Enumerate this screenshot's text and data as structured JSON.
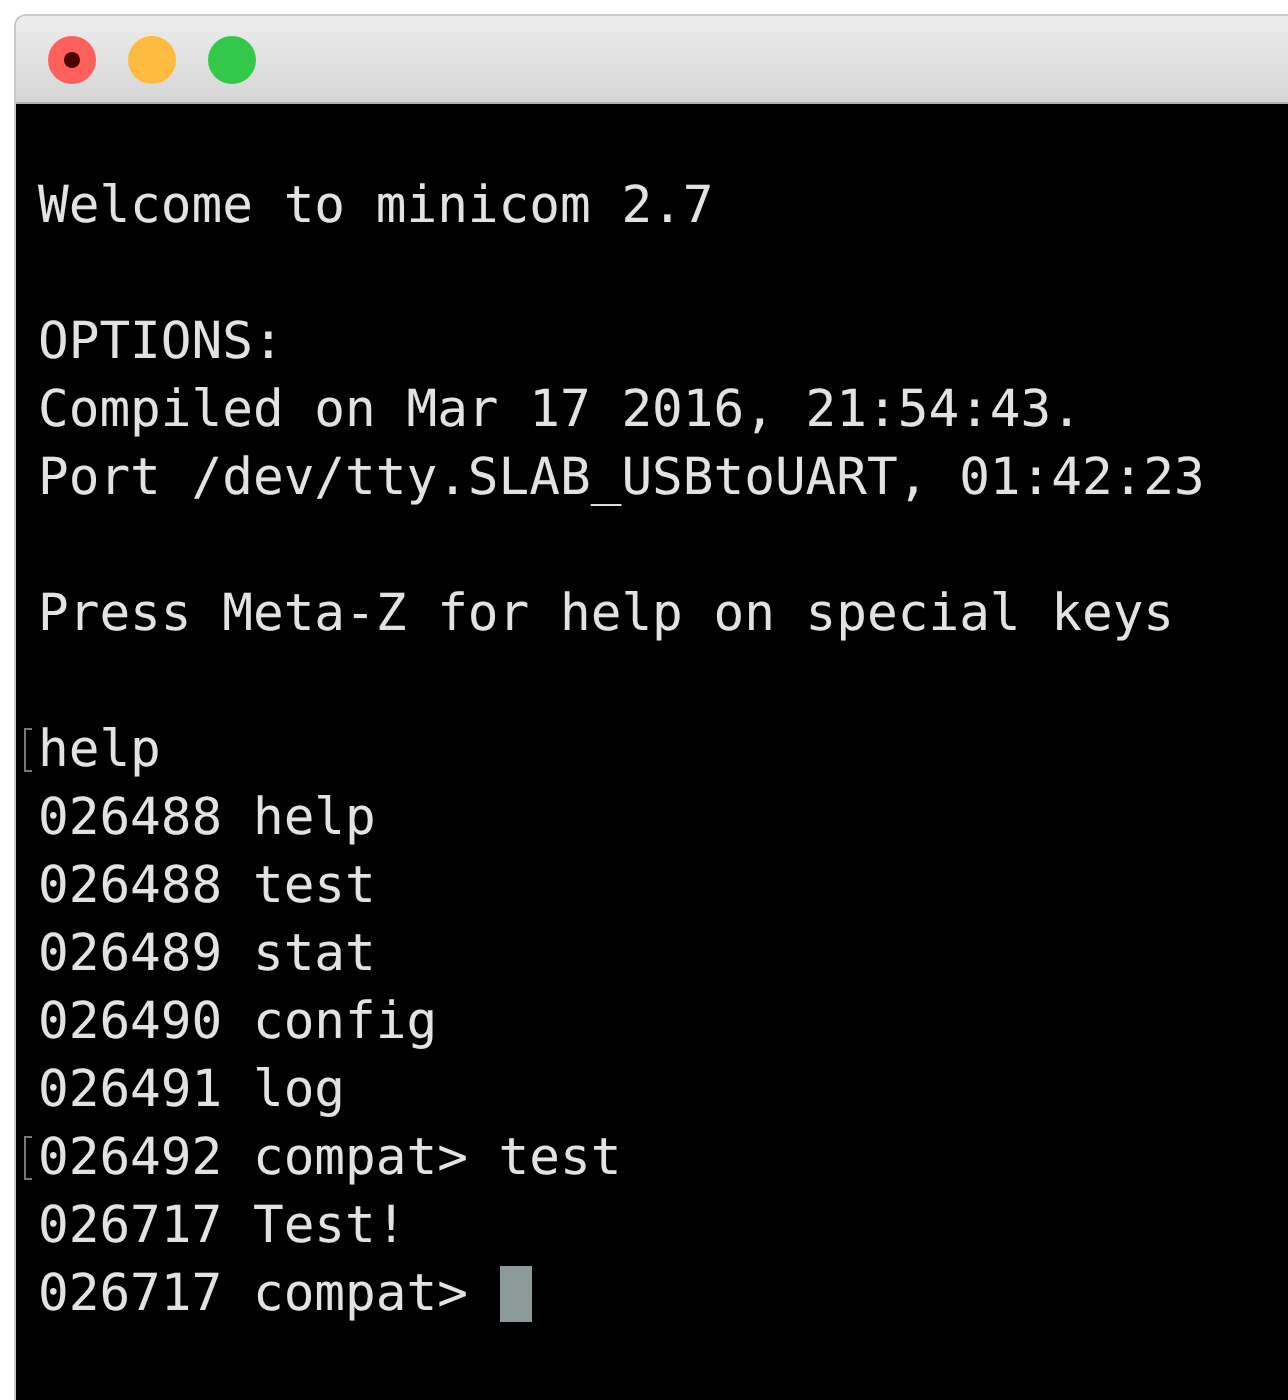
{
  "window": {
    "buttons": [
      {
        "kind": "close"
      },
      {
        "kind": "minimize"
      },
      {
        "kind": "zoom"
      }
    ]
  },
  "terminal": {
    "blocks": [
      {
        "lines": [
          {
            "text": "Welcome to minicom 2.7",
            "marked": false,
            "cursor": false
          }
        ]
      },
      {
        "lines": [
          {
            "text": "OPTIONS:",
            "marked": false,
            "cursor": false
          },
          {
            "text": "Compiled on Mar 17 2016, 21:54:43.",
            "marked": false,
            "cursor": false
          },
          {
            "text": "Port /dev/tty.SLAB_USBtoUART, 01:42:23",
            "marked": false,
            "cursor": false
          }
        ]
      },
      {
        "lines": [
          {
            "text": "Press Meta-Z for help on special keys",
            "marked": false,
            "cursor": false
          }
        ]
      },
      {
        "lines": [
          {
            "text": "help",
            "marked": true,
            "cursor": false
          },
          {
            "text": "026488 help",
            "marked": false,
            "cursor": false
          },
          {
            "text": "026488 test",
            "marked": false,
            "cursor": false
          },
          {
            "text": "026489 stat",
            "marked": false,
            "cursor": false
          },
          {
            "text": "026490 config",
            "marked": false,
            "cursor": false
          },
          {
            "text": "026491 log",
            "marked": false,
            "cursor": false
          },
          {
            "text": "026492 compat> test",
            "marked": true,
            "cursor": false
          },
          {
            "text": "026717 Test!",
            "marked": false,
            "cursor": false
          },
          {
            "text": "026717 compat>",
            "marked": false,
            "cursor": true
          }
        ]
      }
    ]
  }
}
